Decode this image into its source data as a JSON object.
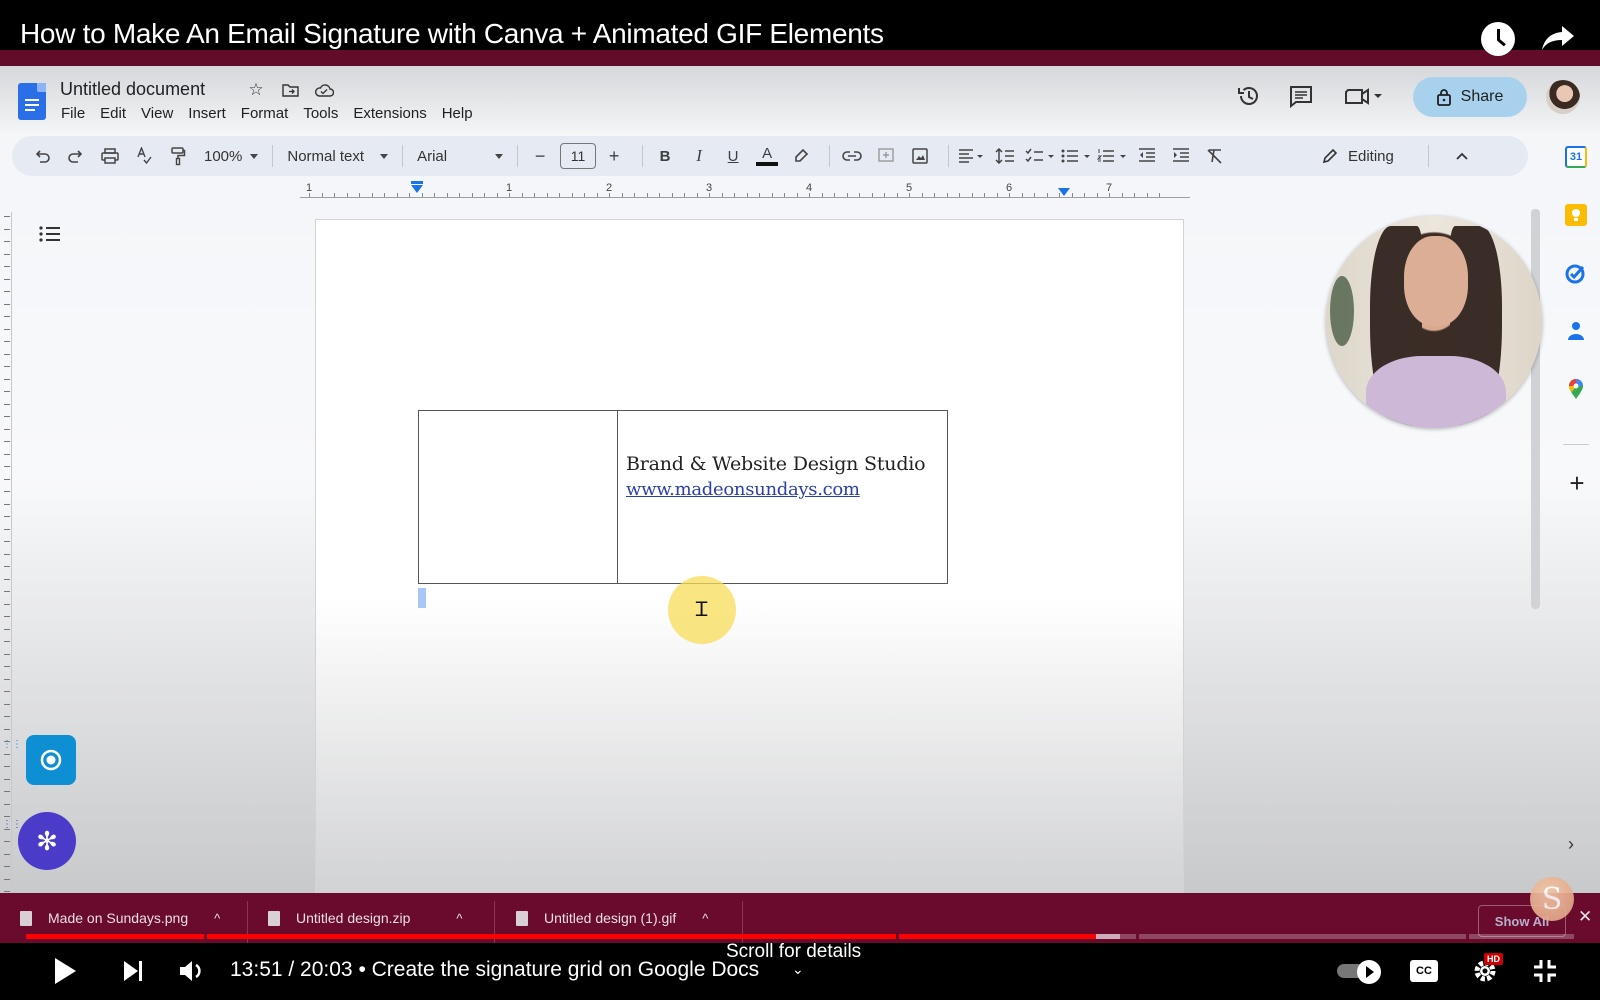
{
  "video": {
    "title": "How to Make An Email Signature with Canva + Animated GIF Elements",
    "current_time": "13:51",
    "duration": "20:03",
    "time_label": "13:51 / 20:03 • Create the signature grid on Google Docs",
    "chapter": "Create the signature grid on Google Docs",
    "scroll_hint": "Scroll for details",
    "progress_fraction": 0.691,
    "buffer_fraction": 0.707,
    "hd_badge": "HD",
    "cc_label": "CC",
    "colors": {
      "played": "#ff0000",
      "brand_maroon": "#6a0b2e"
    }
  },
  "docs": {
    "title": "Untitled document",
    "menu": [
      "File",
      "Edit",
      "View",
      "Insert",
      "Format",
      "Tools",
      "Extensions",
      "Help"
    ],
    "share_label": "Share",
    "toolbar": {
      "zoom": "100%",
      "style": "Normal text",
      "font": "Arial",
      "font_size": "11",
      "bold": "B",
      "italic": "I",
      "underline": "U",
      "text_color": "A",
      "mode": "Editing"
    },
    "ruler": {
      "labels": [
        "1",
        "1",
        "2",
        "3",
        "4",
        "5",
        "6",
        "7"
      ]
    },
    "signature": {
      "line1": "Brand & Website Design Studio",
      "link": "www.madeonsundays.com"
    },
    "side_apps": [
      {
        "name": "calendar",
        "label": "31",
        "color": "#1a73e8"
      },
      {
        "name": "keep",
        "label": "",
        "color": "#fbbc04"
      },
      {
        "name": "tasks",
        "label": "",
        "color": "#1a73e8"
      },
      {
        "name": "contacts",
        "label": "",
        "color": "#1a73e8"
      },
      {
        "name": "maps",
        "label": "",
        "color": "#34a853"
      }
    ],
    "accent": "#1a73e8"
  },
  "downloads": {
    "items": [
      {
        "name": "Made on Sundays.png"
      },
      {
        "name": "Untitled design.zip"
      },
      {
        "name": "Untitled design (1).gif"
      }
    ],
    "show_all": "Show All",
    "close": "✕"
  },
  "channel": {
    "logo_letter": "S"
  }
}
